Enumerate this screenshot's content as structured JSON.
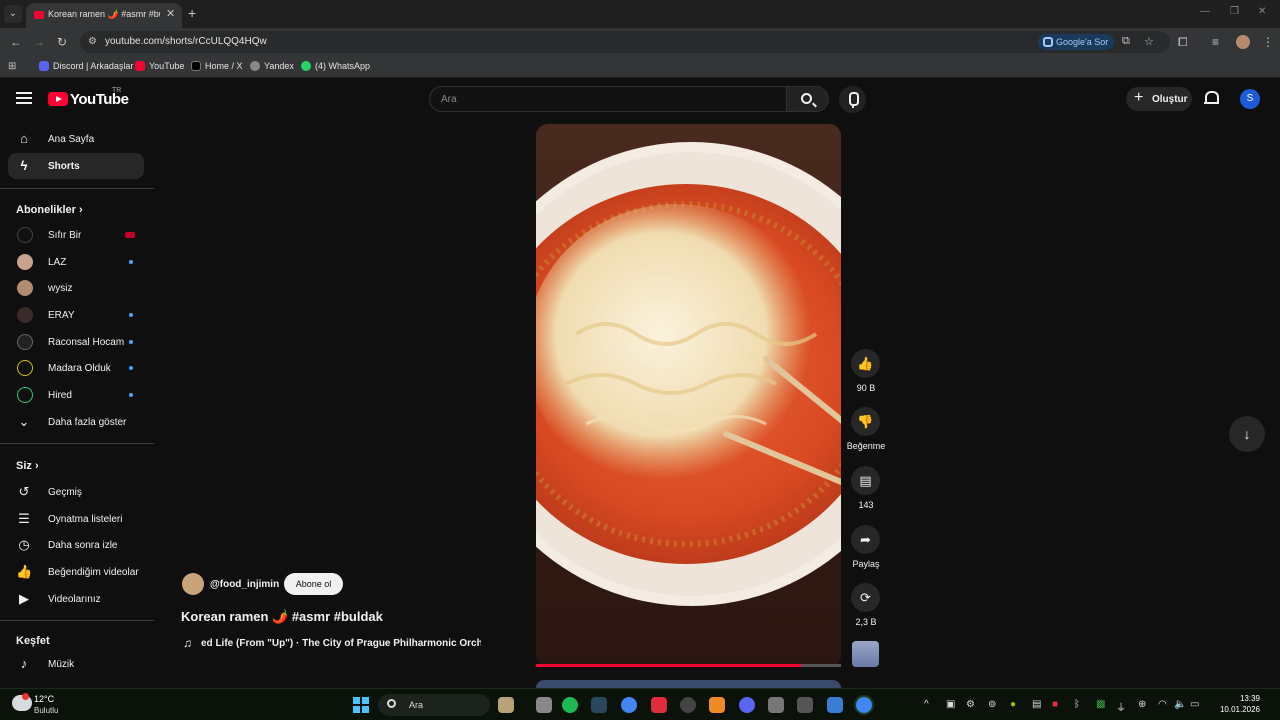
{
  "browser": {
    "tab_title": "Korean ramen 🌶️ #asmr #buldak",
    "url": "youtube.com/shorts/rCcULQQ4HQw",
    "google_ask": "Google'a Sor",
    "bookmarks": [
      "Discord | Arkadaşlar",
      "YouTube",
      "Home / X",
      "Yandex",
      "(4) WhatsApp"
    ]
  },
  "masthead": {
    "logo": "YouTube",
    "region": "TR",
    "search_placeholder": "Ara",
    "create_label": "Oluştur",
    "avatar_letter": "S"
  },
  "sidebar": {
    "main": [
      {
        "label": "Ana Sayfa",
        "icon": "home-icon"
      },
      {
        "label": "Shorts",
        "icon": "shorts-icon",
        "active": true
      }
    ],
    "subscriptions_title": "Abonelikler",
    "subscriptions": [
      {
        "label": "Sıfır Bir",
        "status": "live"
      },
      {
        "label": "LAZ",
        "status": "new"
      },
      {
        "label": "wysiz",
        "status": "none"
      },
      {
        "label": "ERAY",
        "status": "new"
      },
      {
        "label": "Raconsal Hocam",
        "status": "new"
      },
      {
        "label": "Madara Olduk",
        "status": "new"
      },
      {
        "label": "Hired",
        "status": "new"
      }
    ],
    "show_more": "Daha fazla göster",
    "you_title": "Siz",
    "you": [
      {
        "label": "Geçmiş",
        "icon": "history-icon"
      },
      {
        "label": "Oynatma listeleri",
        "icon": "playlist-icon"
      },
      {
        "label": "Daha sonra izle",
        "icon": "clock-icon"
      },
      {
        "label": "Beğendiğim videolar",
        "icon": "thumbs-up-icon"
      },
      {
        "label": "Videolarınız",
        "icon": "video-icon"
      }
    ],
    "explore_title": "Keşfet",
    "explore": [
      {
        "label": "Müzik",
        "icon": "music-icon"
      }
    ]
  },
  "short": {
    "channel": "@food_injimin",
    "subscribe": "Abone ol",
    "title": "Korean ramen 🌶️ #asmr #buldak",
    "music": "ed Life (From \"Up\") · The City of Prague Philharmonic Orchestra",
    "likes": "90 B",
    "dislike_label": "Beğenme",
    "comments": "143",
    "share_label": "Paylaş",
    "remix": "2,3 B",
    "progress": 0.87
  },
  "taskbar": {
    "temperature": "12°C",
    "weather": "Bulutlu",
    "search": "Ara",
    "time": "13:39",
    "date": "10.01.2026"
  },
  "colors": {
    "background": "#0f0f0f",
    "accent_red": "#ff0033",
    "link_blue": "#3ea6ff"
  }
}
